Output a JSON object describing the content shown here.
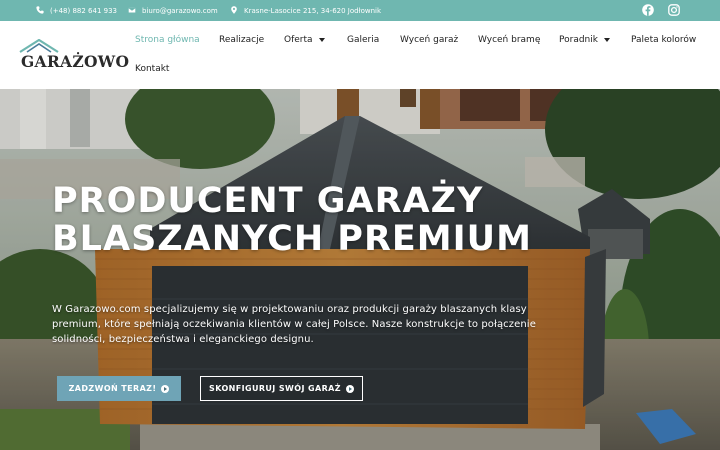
{
  "topbar": {
    "phone": "(+48) 882 641 933",
    "email": "biuro@garazowo.com",
    "address": "Krasne-Lasocice 215, 34-620 Jodłownik",
    "social": [
      "facebook-icon",
      "instagram-icon"
    ]
  },
  "logo": {
    "text": "GARAŻOWO"
  },
  "nav": {
    "items": [
      {
        "label": "Strona główna",
        "active": true
      },
      {
        "label": "Realizacje"
      },
      {
        "label": "Oferta",
        "dropdown": true
      },
      {
        "label": "Galeria"
      },
      {
        "label": "Wyceń garaż"
      },
      {
        "label": "Wyceń bramę"
      },
      {
        "label": "Poradnik",
        "dropdown": true
      },
      {
        "label": "Paleta kolorów"
      },
      {
        "label": "Kontakt"
      }
    ]
  },
  "hero": {
    "title": "PRODUCENT GARAŻY BLASZANYCH PREMIUM",
    "description": "W Garazowo.com specjalizujemy się w projektowaniu oraz produkcji garaży blaszanych klasy premium, które spełniają oczekiwania klientów w całej Polsce. Nasze konstrukcje to połączenie solidności, bezpieczeństwa i eleganckiego designu.",
    "cta_call": "ZADZWOŃ TERAZ!",
    "cta_config": "SKONFIGURUJ SWÓJ GARAŻ"
  },
  "colors": {
    "accent": "#6fb7b0",
    "button": "#6fa4b6"
  }
}
